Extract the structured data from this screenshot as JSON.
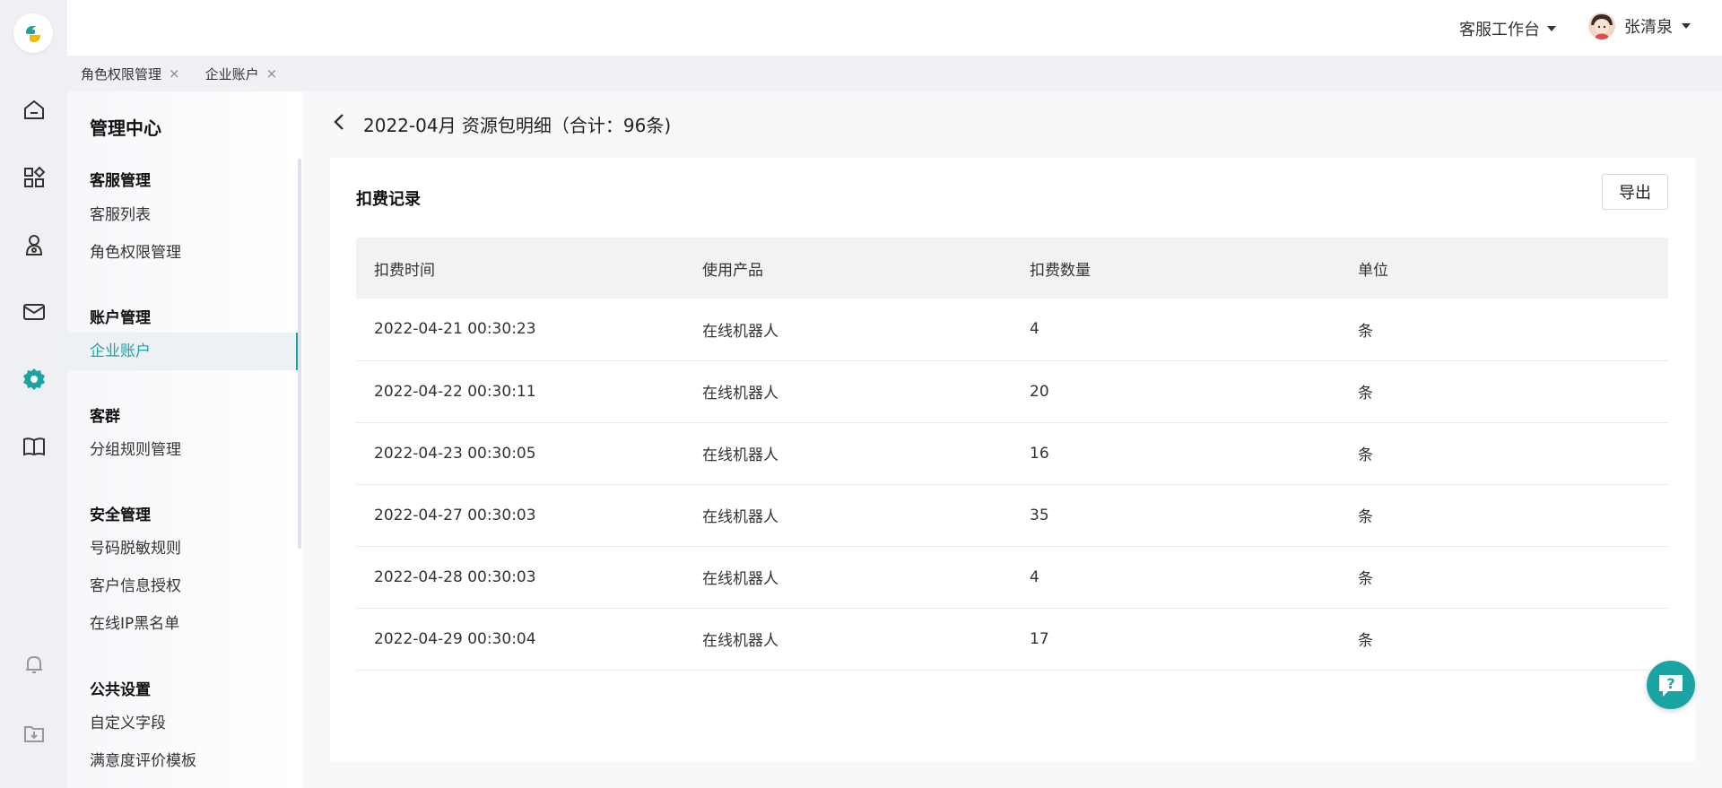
{
  "header": {
    "workbench_label": "客服工作台",
    "user_name": "张清泉"
  },
  "tabs": [
    {
      "label": "角色权限管理",
      "close": "×"
    },
    {
      "label": "企业账户",
      "close": "×"
    }
  ],
  "rail": {
    "icons": [
      "home-icon",
      "apps-icon",
      "user-icon",
      "mail-icon",
      "settings-icon",
      "book-icon",
      "bell-icon",
      "download-icon"
    ],
    "active": "settings-icon",
    "accent": "#1aa3a3"
  },
  "sidemenu": {
    "title": "管理中心",
    "groups": [
      {
        "label": "客服管理",
        "items": [
          "客服列表",
          "角色权限管理"
        ]
      },
      {
        "label": "账户管理",
        "items": [
          "企业账户"
        ]
      },
      {
        "label": "客群",
        "items": [
          "分组规则管理"
        ]
      },
      {
        "label": "安全管理",
        "items": [
          "号码脱敏规则",
          "客户信息授权",
          "在线IP黑名单"
        ]
      },
      {
        "label": "公共设置",
        "items": [
          "自定义字段",
          "满意度评价模板"
        ]
      }
    ],
    "active_item": "企业账户"
  },
  "page": {
    "title": "2022-04月 资源包明细（合计：96条)",
    "card_title": "扣费记录",
    "export_label": "导出"
  },
  "table": {
    "columns": [
      "扣费时间",
      "使用产品",
      "扣费数量",
      "单位"
    ],
    "rows": [
      [
        "2022-04-21 00:30:23",
        "在线机器人",
        "4",
        "条"
      ],
      [
        "2022-04-22 00:30:11",
        "在线机器人",
        "20",
        "条"
      ],
      [
        "2022-04-23 00:30:05",
        "在线机器人",
        "16",
        "条"
      ],
      [
        "2022-04-27 00:30:03",
        "在线机器人",
        "35",
        "条"
      ],
      [
        "2022-04-28 00:30:03",
        "在线机器人",
        "4",
        "条"
      ],
      [
        "2022-04-29 00:30:04",
        "在线机器人",
        "17",
        "条"
      ]
    ]
  },
  "help": {
    "icon": "question-icon",
    "symbol": "?"
  }
}
